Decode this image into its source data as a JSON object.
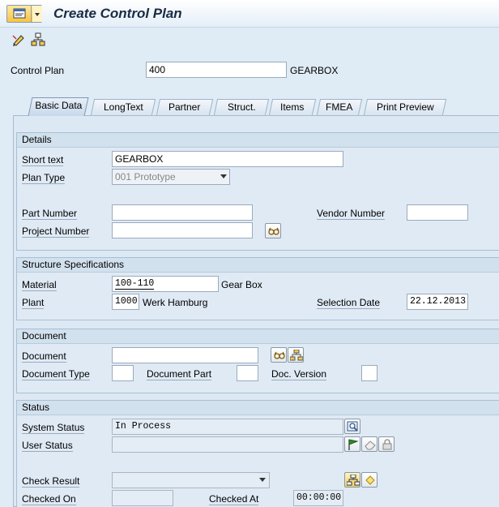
{
  "window": {
    "title": "Create Control Plan"
  },
  "header": {
    "control_plan_label": "Control Plan",
    "control_plan_number": "400",
    "control_plan_name": "GEARBOX"
  },
  "tabs": [
    {
      "label": "Basic Data"
    },
    {
      "label": "LongText"
    },
    {
      "label": "Partner"
    },
    {
      "label": "Struct."
    },
    {
      "label": "Items"
    },
    {
      "label": "FMEA"
    },
    {
      "label": "Print Preview"
    }
  ],
  "details": {
    "title": "Details",
    "short_text_label": "Short text",
    "short_text_value": "GEARBOX",
    "plan_type_label": "Plan Type",
    "plan_type_value": "001 Prototype",
    "part_number_label": "Part Number",
    "part_number_value": "",
    "vendor_number_label": "Vendor Number",
    "vendor_number_value": "",
    "project_number_label": "Project Number",
    "project_number_value": ""
  },
  "structure": {
    "title": "Structure Specifications",
    "material_label": "Material",
    "material_value": "100-110",
    "material_desc": "Gear Box",
    "plant_label": "Plant",
    "plant_value": "1000",
    "plant_desc": "Werk Hamburg",
    "selection_date_label": "Selection Date",
    "selection_date_value": "22.12.2013"
  },
  "document": {
    "title": "Document",
    "document_label": "Document",
    "document_value": "",
    "document_type_label": "Document Type",
    "document_type_value": "",
    "document_part_label": "Document Part",
    "document_part_value": "",
    "doc_version_label": "Doc. Version",
    "doc_version_value": ""
  },
  "status": {
    "title": "Status",
    "system_status_label": "System Status",
    "system_status_value": "In Process",
    "user_status_label": "User Status",
    "user_status_value": "",
    "check_result_label": "Check Result",
    "check_result_value": "",
    "checked_on_label": "Checked On",
    "checked_on_value": "",
    "checked_at_label": "Checked At",
    "checked_at_value": "00:00:00"
  },
  "icons": {
    "menu": "menu-icon",
    "toolbar_1": "edit-pencil-icon",
    "toolbar_2": "hierarchy-icon",
    "project_search": "glasses-icon",
    "document_display": "glasses-icon",
    "document_structure": "tree-icon",
    "system_status_detail": "magnifier-icon",
    "user_status_flag": "flag-icon",
    "user_status_eraser": "eraser-icon",
    "user_status_lock": "lock-icon",
    "check_result_hierarchy": "hierarchy-icon",
    "check_result_diamond": "diamond-icon"
  },
  "colors": {
    "background": "#dfebf5",
    "title_text": "#1a2b44",
    "menu_button": "#f5c542"
  }
}
